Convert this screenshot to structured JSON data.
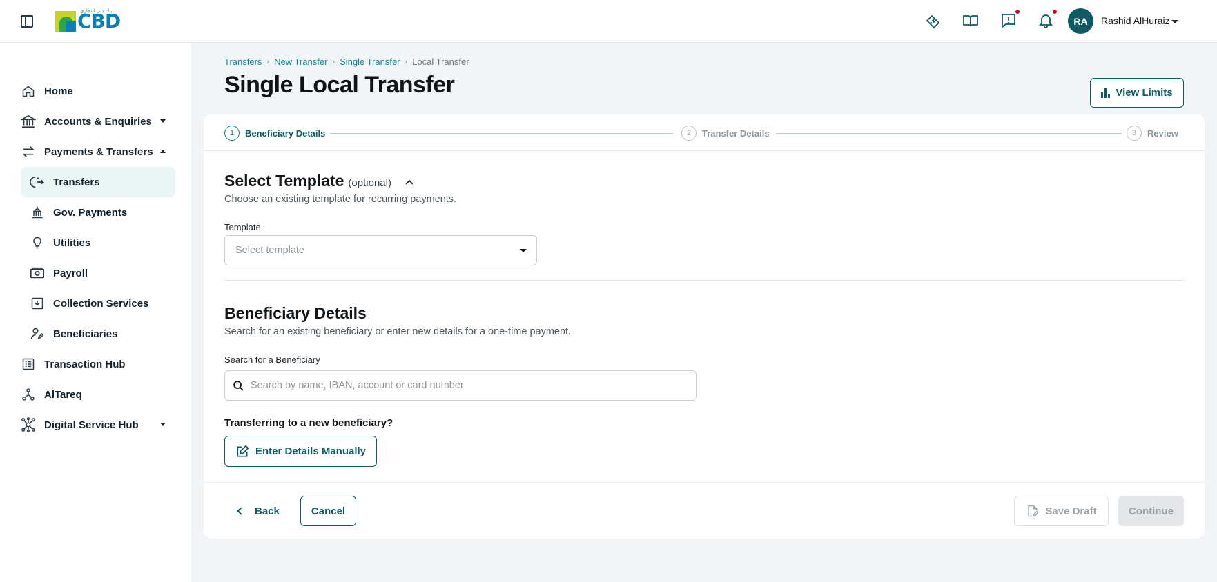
{
  "header": {
    "logo_text": "CBD",
    "logo_arabic": "بنك دبي التجاري",
    "user_initials": "RA",
    "user_name": "Rashid AlHuraiz"
  },
  "sidebar": {
    "items": [
      {
        "label": "Home",
        "icon": "home-icon"
      },
      {
        "label": "Accounts & Enquiries",
        "icon": "bank-icon",
        "expandable": true
      },
      {
        "label": "Payments & Transfers",
        "icon": "transfer-arrows-icon",
        "expanded": true
      },
      {
        "label": "Transfers",
        "icon": "transfer-icon",
        "active": true
      },
      {
        "label": "Gov. Payments",
        "icon": "government-icon"
      },
      {
        "label": "Utilities",
        "icon": "lightbulb-icon"
      },
      {
        "label": "Payroll",
        "icon": "cash-icon"
      },
      {
        "label": "Collection Services",
        "icon": "inbox-download-icon"
      },
      {
        "label": "Beneficiaries",
        "icon": "user-edit-icon"
      },
      {
        "label": "Transaction Hub",
        "icon": "list-icon"
      },
      {
        "label": "AlTareq",
        "icon": "network-icon"
      },
      {
        "label": "Digital Service Hub",
        "icon": "hub-icon",
        "expandable": true
      }
    ]
  },
  "breadcrumb": [
    "Transfers",
    "New Transfer",
    "Single Transfer",
    "Local Transfer"
  ],
  "page": {
    "title": "Single Local Transfer",
    "view_limits_label": "View Limits"
  },
  "stepper": {
    "steps": [
      {
        "num": "1",
        "label": "Beneficiary Details"
      },
      {
        "num": "2",
        "label": "Transfer Details"
      },
      {
        "num": "3",
        "label": "Review"
      }
    ]
  },
  "template_section": {
    "title": "Select Template",
    "optional": "(optional)",
    "description": "Choose an existing template for recurring payments.",
    "field_label": "Template",
    "placeholder": "Select template"
  },
  "beneficiary_section": {
    "title": "Beneficiary Details",
    "description": "Search for an existing beneficiary or enter new details for a one-time payment.",
    "field_label": "Search for a Beneficiary",
    "placeholder": "Search by name, IBAN, account or card number",
    "new_question": "Transferring to a new beneficiary?",
    "manual_label": "Enter Details Manually"
  },
  "footer": {
    "back_label": "Back",
    "cancel_label": "Cancel",
    "save_draft_label": "Save Draft",
    "continue_label": "Continue"
  },
  "colors": {
    "primary": "#0d5a63",
    "accent": "#0e8796",
    "notification_dot": "#c8102e"
  }
}
